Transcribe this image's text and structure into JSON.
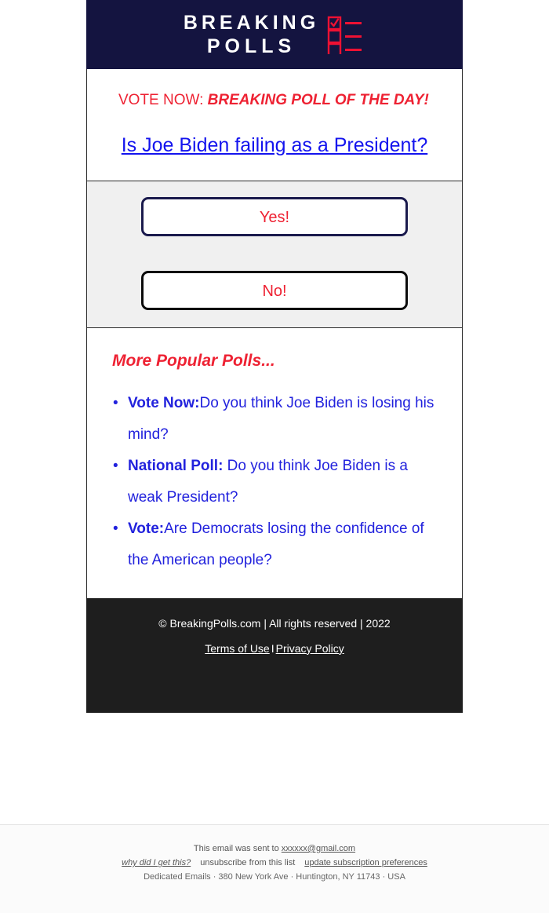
{
  "header": {
    "logo_line_1": "BREAKING",
    "logo_line_2": "POLLS",
    "logo_mark_name": "poll-checkbox-icon",
    "bg_color": "#141440",
    "accent_color": "#ee2233"
  },
  "intro": {
    "kicker_lead": "VOTE NOW: ",
    "kicker_emphasis": "BREAKING POLL OF THE DAY!",
    "question": "Is Joe Biden failing as a President?"
  },
  "vote": {
    "yes_label": "Yes!",
    "no_label": "No!",
    "bg_color": "#f0f0f0",
    "yes_border_color": "#1a1a4d",
    "no_border_color": "#0b0b0b",
    "text_color": "#ee2233"
  },
  "more_polls": {
    "title": "More Popular Polls...",
    "items": [
      {
        "prefix": "Vote Now:",
        "text": "Do you think Joe Biden is losing his mind?"
      },
      {
        "prefix": "National Poll:",
        "text": " Do you think Joe Biden is a weak President?"
      },
      {
        "prefix": "Vote:",
        "text": "Are Democrats losing the confidence of the American people?"
      }
    ]
  },
  "footer": {
    "copyright": "© BreakingPolls.com | All rights reserved | 2022",
    "terms_label": "Terms of Use",
    "separator": "I",
    "privacy_label": "Privacy Policy",
    "bg_color": "#1e1e1e"
  },
  "mail_footer": {
    "sent_to_prefix": "This email was sent to ",
    "recipient_email": "xxxxxx@gmail.com",
    "why_link": "why did I get this?",
    "unsubscribe_link": "unsubscribe from this list",
    "update_prefs_link": "update subscription preferences",
    "address": "Dedicated Emails · 380 New York Ave · Huntington, NY 11743 · USA"
  }
}
